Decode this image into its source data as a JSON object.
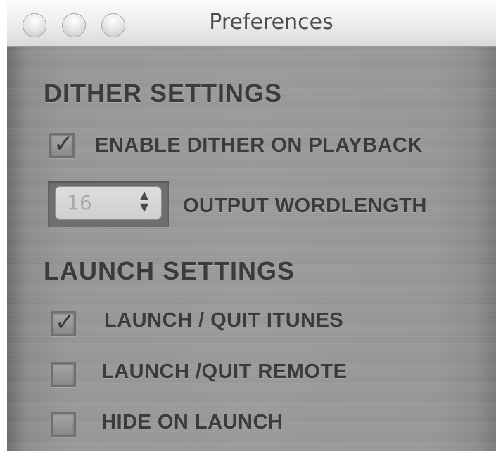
{
  "window": {
    "title": "Preferences"
  },
  "dither": {
    "heading": "DITHER SETTINGS",
    "enable_label": "ENABLE DITHER ON PLAYBACK",
    "enable_checked": true,
    "wordlength_value": "16",
    "wordlength_label": "OUTPUT WORDLENGTH"
  },
  "launch": {
    "heading": "LAUNCH SETTINGS",
    "items": [
      {
        "label": "LAUNCH / QUIT ITUNES",
        "checked": true
      },
      {
        "label": "LAUNCH /QUIT REMOTE",
        "checked": false
      },
      {
        "label": "HIDE ON LAUNCH",
        "checked": false
      }
    ]
  },
  "icons": {
    "checkmark": "checkmark-icon",
    "stepper_arrows": "up-down-arrows-icon"
  }
}
